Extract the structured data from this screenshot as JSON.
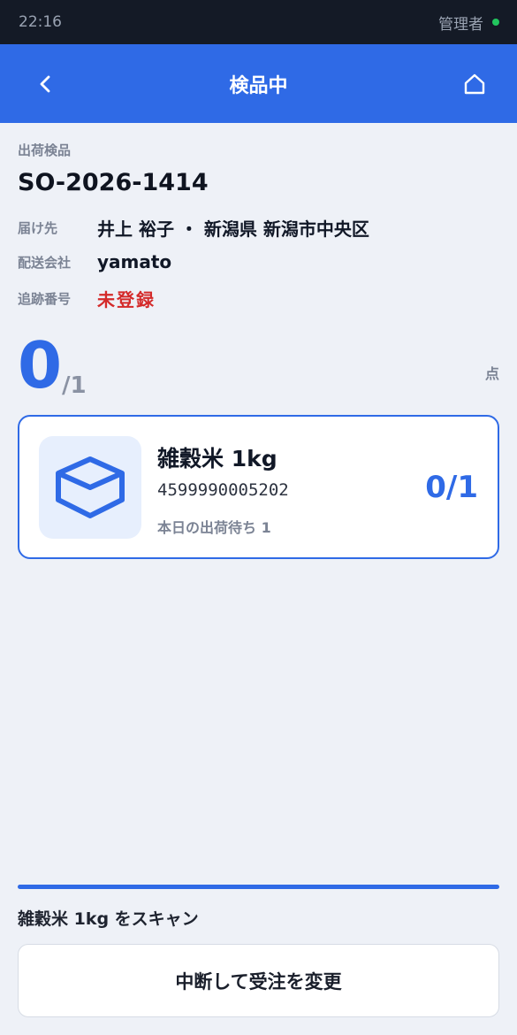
{
  "status_bar": {
    "time": "22:16",
    "user": "管理者"
  },
  "app_bar": {
    "title": "検品中"
  },
  "order": {
    "section_label": "出荷検品",
    "id": "SO-2026-1414",
    "rows": [
      {
        "key": "届け先",
        "value": "井上 裕子 ・ 新潟県 新潟市中央区"
      },
      {
        "key": "配送会社",
        "value": "yamato"
      },
      {
        "key": "追跡番号",
        "value": "未登録"
      }
    ]
  },
  "counter": {
    "scanned": "0",
    "total": "/1",
    "unit": "点"
  },
  "item": {
    "name": "雑穀米 1kg",
    "code": "4599990005202",
    "waiting": "本日の出荷待ち 1",
    "count": "0/1"
  },
  "footer": {
    "progress": 1.0,
    "scan_prompt": "雑穀米 1kg をスキャン",
    "abort_label": "中断して受注を変更"
  },
  "colors": {
    "primary": "#2f6ae6",
    "danger": "#d42a2a",
    "status_dot": "#22c55e"
  }
}
